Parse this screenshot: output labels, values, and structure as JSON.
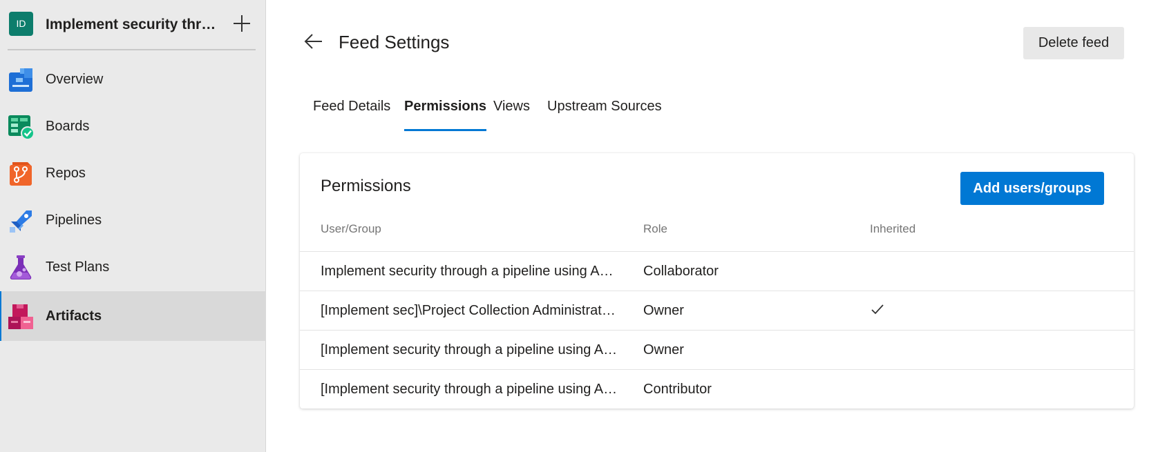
{
  "sidebar": {
    "project_initials": "ID",
    "project_name": "Implement security through a pipeline using Azure DevOps",
    "items": [
      {
        "label": "Overview"
      },
      {
        "label": "Boards"
      },
      {
        "label": "Repos"
      },
      {
        "label": "Pipelines"
      },
      {
        "label": "Test Plans"
      },
      {
        "label": "Artifacts",
        "active": true
      }
    ]
  },
  "header": {
    "title": "Feed Settings",
    "delete_label": "Delete feed"
  },
  "tabs": [
    {
      "label": "Feed Details"
    },
    {
      "label": "Permissions",
      "selected": true
    },
    {
      "label": "Views"
    },
    {
      "label": "Upstream Sources"
    }
  ],
  "permissions": {
    "title": "Permissions",
    "add_label": "Add users/groups",
    "columns": [
      "User/Group",
      "Role",
      "Inherited"
    ],
    "rows": [
      {
        "user": "Implement security through a pipeline using Azure DevOps Build Service",
        "role": "Collaborator",
        "inherited": false
      },
      {
        "user": "[Implement sec]\\Project Collection Administrators",
        "role": "Owner",
        "inherited": true
      },
      {
        "user": "[Implement security through a pipeline using Azure DevOps]\\Project Administrators",
        "role": "Owner",
        "inherited": false
      },
      {
        "user": "[Implement security through a pipeline using Azure DevOps]\\Contributors",
        "role": "Contributor",
        "inherited": false
      }
    ]
  },
  "colors": {
    "accent": "#0078d4",
    "sidebar_bg": "#eaeaea",
    "project_avatar": "#0d7d6c"
  }
}
